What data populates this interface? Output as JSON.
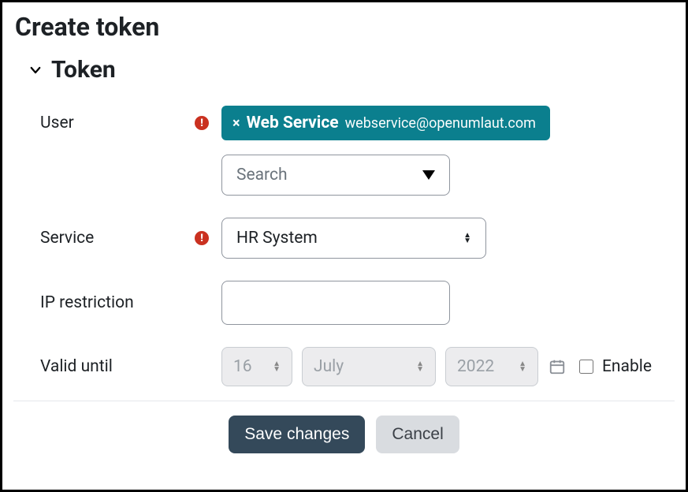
{
  "page": {
    "title": "Create token"
  },
  "section": {
    "title": "Token"
  },
  "fields": {
    "user": {
      "label": "User",
      "required": true,
      "chip": {
        "name": "Web Service",
        "email": "webservice@openumlaut.com"
      },
      "search_placeholder": "Search"
    },
    "service": {
      "label": "Service",
      "required": true,
      "value": "HR System"
    },
    "ip_restriction": {
      "label": "IP restriction",
      "value": ""
    },
    "valid_until": {
      "label": "Valid until",
      "day": "16",
      "month": "July",
      "year": "2022",
      "enable_label": "Enable",
      "enabled": false
    }
  },
  "actions": {
    "save": "Save changes",
    "cancel": "Cancel"
  }
}
